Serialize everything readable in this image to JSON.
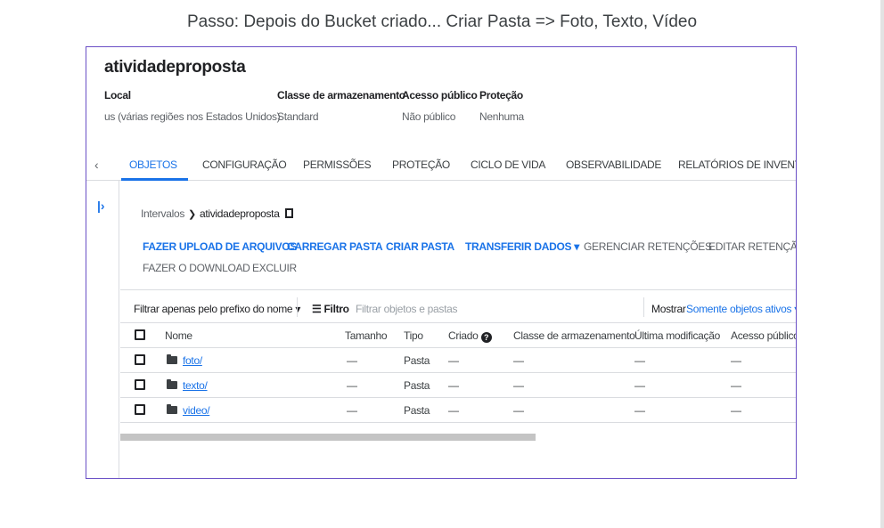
{
  "caption": "Passo: Depois do Bucket criado... Criar Pasta => Foto, Texto, Vídeo",
  "bucket": {
    "name": "atividadeproposta",
    "meta": [
      {
        "label": "Local",
        "value": "us (várias regiões nos Estados Unidos)"
      },
      {
        "label": "Classe de armazenamento",
        "value": "Standard"
      },
      {
        "label": "Acesso público",
        "value": "Não público"
      },
      {
        "label": "Proteção",
        "value": "Nenhuma"
      }
    ]
  },
  "tabs": [
    "OBJETOS",
    "CONFIGURAÇÃO",
    "PERMISSÕES",
    "PROTEÇÃO",
    "CICLO DE VIDA",
    "OBSERVABILIDADE",
    "RELATÓRIOS DE INVENTÁRIO"
  ],
  "active_tab": "OBJETOS",
  "breadcrumb": {
    "root": "Intervalos",
    "current": "atividadeproposta"
  },
  "actions": {
    "upload_files": "FAZER UPLOAD DE ARQUIVOS",
    "upload_folder": "CARREGAR PASTA",
    "create_folder": "CRIAR PASTA",
    "transfer_data": "TRANSFERIR DADOS",
    "manage_retention": "GERENCIAR RETENÇÕES",
    "edit_retention": "EDITAR RETENÇÃO",
    "download": "FAZER O DOWNLOAD",
    "delete": "EXCLUIR"
  },
  "filter": {
    "prefix_select": "Filtrar apenas pelo prefixo do nome",
    "filter_label": "Filtro",
    "filter_placeholder": "Filtrar objetos e pastas",
    "show_label": "Mostrar",
    "show_value": "Somente objetos ativos"
  },
  "table": {
    "columns": [
      "Nome",
      "Tamanho",
      "Tipo",
      "Criado",
      "Classe de armazenamento",
      "Última modificação",
      "Acesso público"
    ],
    "rows": [
      {
        "name": "foto/",
        "size": "—",
        "type": "Pasta",
        "created": "—",
        "storage_class": "—",
        "modified": "—",
        "public_access": "—"
      },
      {
        "name": "texto/",
        "size": "—",
        "type": "Pasta",
        "created": "—",
        "storage_class": "—",
        "modified": "—",
        "public_access": "—"
      },
      {
        "name": "video/",
        "size": "—",
        "type": "Pasta",
        "created": "—",
        "storage_class": "—",
        "modified": "—",
        "public_access": "—"
      }
    ]
  },
  "icons": {
    "caret": "▾",
    "chevron_right": "❯",
    "chevron_left": "‹",
    "panel_toggle": "|›",
    "filter": "☰",
    "help": "?"
  },
  "colors": {
    "accent": "#1a73e8",
    "frame_border": "#6a4fc6"
  }
}
